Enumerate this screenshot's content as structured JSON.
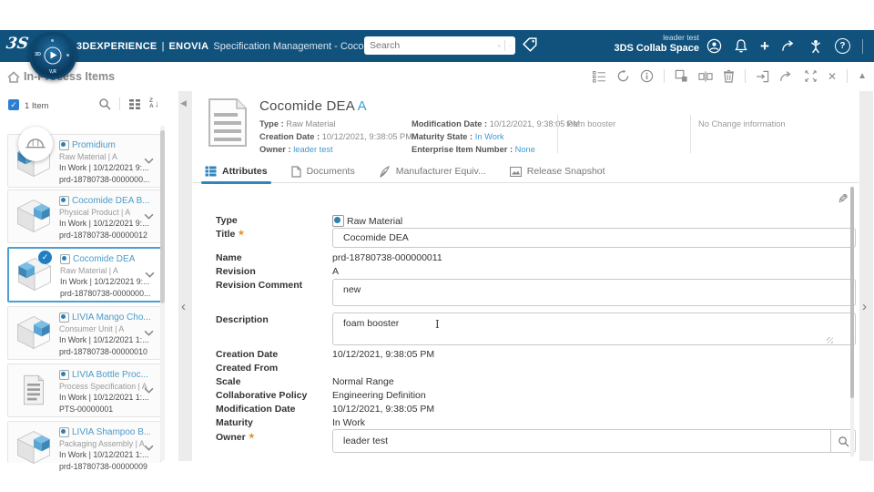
{
  "colors": {
    "topbar_bg": "#11527D",
    "accent_blue": "#2E86C1",
    "link_blue": "#3F9AD2",
    "selected_border": "#4C9FD4",
    "required_orange": "#E09A2D"
  },
  "glyphs": {
    "check": "✓",
    "close": "✕",
    "collapse_up": "▲",
    "triangle_left": "◀",
    "chevron_left": "‹",
    "chevron_right": "›",
    "star": "★",
    "plus": "+",
    "question": "?",
    "pencil": "✎",
    "sort_z": "Z",
    "sort_a": "A",
    "arrow_down": "↓",
    "ibeam": "I",
    "brand_mark": "3S"
  },
  "topbar": {
    "brand": "3DEXPERIENCE",
    "divider": "|",
    "app": "ENOVIA",
    "context": "Specification Management - Cocomi...",
    "search_placeholder": "Search",
    "user_line1": "leader test",
    "user_line2": "3DS Collab Space",
    "compass": {
      "west": "3D",
      "south": "V,R"
    },
    "icons": [
      "tag-icon",
      "user-icon",
      "bell-icon",
      "add-icon",
      "share-icon",
      "swym-icon",
      "help-icon",
      "collapse-icon"
    ]
  },
  "breadcrumb": {
    "title": "In-Process Items"
  },
  "actions_toolbar": {
    "icons": [
      "rules-icon",
      "refresh-icon",
      "info-icon",
      "duplicate-icon",
      "compare-icon",
      "delete-icon",
      "open-in-icon",
      "share-icon",
      "expand-icon",
      "close-icon",
      "collapse-up-icon"
    ]
  },
  "sidebar": {
    "count_label": "1 Item",
    "items": [
      {
        "title": "Promidium",
        "type_line": "Raw Material | A",
        "status_line": "In Work | 10/12/2021 9:...",
        "id_line": "prd-18780738-0000000...",
        "thumb": "cube",
        "selected": false
      },
      {
        "title": "Cocomide DEA B...",
        "type_line": "Physical Product | A",
        "status_line": "In Work | 10/12/2021 9:...",
        "id_line": "prd-18780738-00000012",
        "thumb": "cube",
        "selected": false
      },
      {
        "title": "Cocomide DEA",
        "type_line": "Raw Material | A",
        "status_line": "In Work | 10/12/2021 9:...",
        "id_line": "prd-18780738-0000000...",
        "thumb": "cube",
        "selected": true
      },
      {
        "title": "LIVIA Mango Cho...",
        "type_line": "Consumer Unit | A",
        "status_line": "In Work | 10/12/2021 1:...",
        "id_line": "prd-18780738-00000010",
        "thumb": "cube",
        "selected": false
      },
      {
        "title": "LIVIA Bottle Proc...",
        "type_line": "Process Specification | A",
        "status_line": "In Work | 10/12/2021 1:...",
        "id_line": "PTS-00000001",
        "thumb": "doc",
        "selected": false
      },
      {
        "title": "LIVIA Shampoo B...",
        "type_line": "Packaging Assembly | A",
        "status_line": "In Work | 10/12/2021 1:...",
        "id_line": "prd-18780738-00000009",
        "thumb": "cube",
        "selected": false
      }
    ]
  },
  "detail_header": {
    "title": "Cocomide DEA",
    "revision": "A",
    "meta_left": [
      {
        "label": "Type :",
        "value": "Raw Material"
      },
      {
        "label": "Creation Date :",
        "value": "10/12/2021, 9:38:05 PM"
      },
      {
        "label": "Owner :",
        "value": "leader test"
      }
    ],
    "meta_right": [
      {
        "label": "Modification Date :",
        "value": "10/12/2021, 9:38:05 PM"
      },
      {
        "label": "Maturity State :",
        "value": "In Work"
      },
      {
        "label": "Enterprise Item Number :",
        "value": "None"
      }
    ],
    "note1": "foam booster",
    "note2": "No Change information"
  },
  "tabs": [
    {
      "label": "Attributes",
      "active": true
    },
    {
      "label": "Documents",
      "active": false
    },
    {
      "label": "Manufacturer Equiv...",
      "active": false
    },
    {
      "label": "Release Snapshot",
      "active": false
    }
  ],
  "form": {
    "required_marker": "★",
    "rows": [
      {
        "label": "Type",
        "value": "Raw Material"
      },
      {
        "label": "Title",
        "value": "Cocomide DEA",
        "required": true
      },
      {
        "label": "Name",
        "value": "prd-18780738-000000011"
      },
      {
        "label": "Revision",
        "value": "A"
      },
      {
        "label": "Revision Comment",
        "value": "new"
      },
      {
        "label": "Description",
        "value": "foam booster"
      },
      {
        "label": "Creation Date",
        "value": "10/12/2021, 9:38:05 PM"
      },
      {
        "label": "Created From",
        "value": ""
      },
      {
        "label": "Scale",
        "value": "Normal Range"
      },
      {
        "label": "Collaborative Policy",
        "value": "Engineering Definition"
      },
      {
        "label": "Modification Date",
        "value": "10/12/2021, 9:38:05 PM"
      },
      {
        "label": "Maturity",
        "value": "In Work"
      },
      {
        "label": "Owner",
        "value": "leader test",
        "required": true
      }
    ]
  }
}
